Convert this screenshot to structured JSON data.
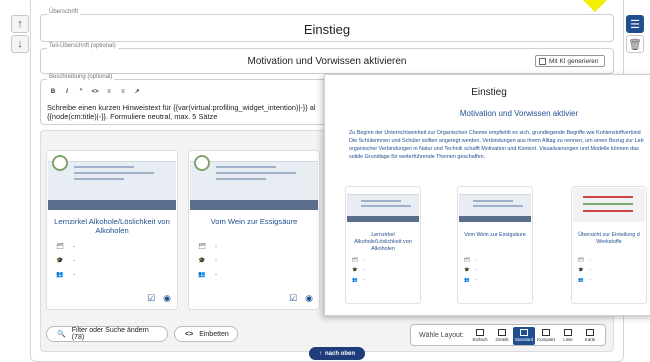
{
  "side": {
    "up_icon": "arrow-up-icon",
    "down_icon": "arrow-down-icon",
    "settings_icon": "sliders-icon",
    "delete_icon": "trash-icon"
  },
  "heading": {
    "label": "Überschrift",
    "value": "Einstieg"
  },
  "subheading": {
    "label": "Teil-Überschrift (optional)",
    "value": "Motivation und Vorwissen aktivieren",
    "ai_label": "Mit KI generieren"
  },
  "description": {
    "label": "Beschreibung (optional)",
    "toolbar": [
      "B",
      "I",
      "”",
      "<>",
      "≡",
      "≡",
      "↗"
    ],
    "line1": "Schreibe einen kurzen Hinweistext für {{var(virtual:profiling_widget_intention)|-}} al",
    "line2": "{{node(cm:title)|-}}. Formuliere neutral, max. 5 Sätze"
  },
  "cards": [
    {
      "title": "Lernzirkel Alkohole/Löslichkeit von Alkoholen",
      "meta": [
        "-",
        "-",
        "-"
      ]
    },
    {
      "title": "Vom Wein zur Essigsäure",
      "meta": [
        "-",
        "-",
        "-"
      ]
    }
  ],
  "controls": {
    "filter_label": "Filter oder Suche ändern (78)",
    "embed_label": "Einbetten",
    "layout_label": "Wähle Layout:",
    "layouts": [
      "Einfach",
      "Geteilt",
      "Standard",
      "Kompakt",
      "Liste",
      "Karte"
    ],
    "active_layout": "Standard",
    "top_label": "nach oben"
  },
  "preview": {
    "title": "Einstieg",
    "subtitle": "Motivation und Vorwissen aktivier",
    "text": [
      "Zu Beginn der Unterrichtseinheit zur Organischen Chemie empfiehlt es sich, grundlegende Begriffe wie Kohlenstoffverbind",
      "Die Schülerinnen und Schüler sollten angeregt werden, Verbindungen aus ihrem Alltag zu nennen, um einen Bezug zur Leb",
      "organischer Verbindungen in Natur und Technik schafft Motivation und Kontext. Visualisierungen und Modelle können das",
      "solide Grundlage für weiterführende Themen geschaffen."
    ],
    "cards": [
      {
        "title": "Lernzirkel Alkohole/Löslichkeit von Alkoholen",
        "meta": [
          "-",
          "-",
          "-"
        ]
      },
      {
        "title": "Vom Wein zur Essigsäure",
        "meta": [
          "-",
          "-",
          "-"
        ]
      },
      {
        "title": "Übersicht zur Einteilung d Werkstoffe",
        "meta": [
          "-",
          "-",
          "-"
        ]
      }
    ]
  },
  "colors": {
    "accent": "#1f4f8f",
    "button_dark": "#1f3d7a",
    "highlight": "#f0f000"
  }
}
